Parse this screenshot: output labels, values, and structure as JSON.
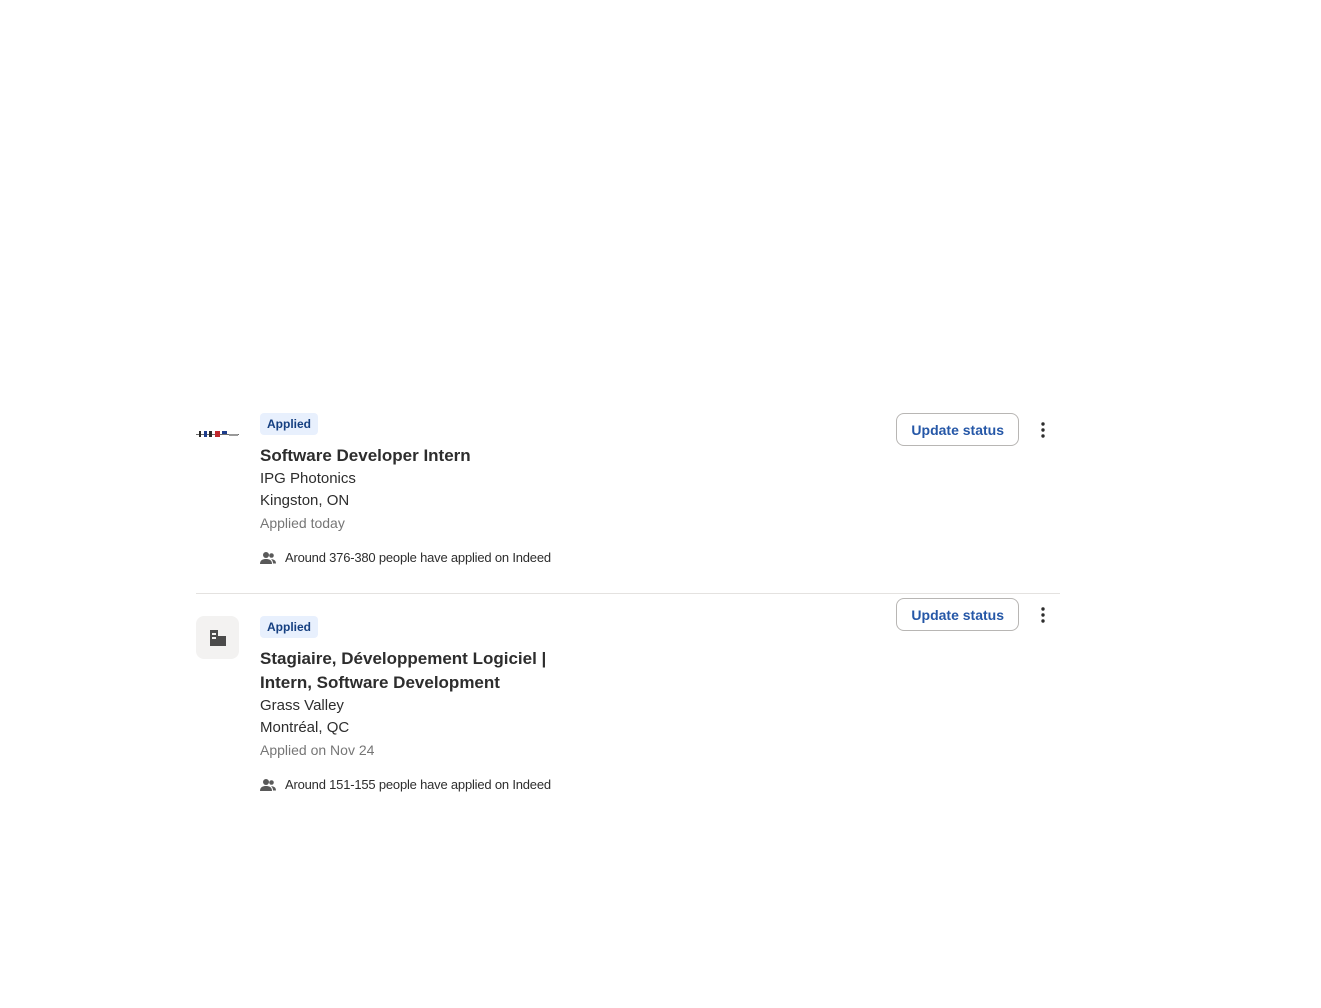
{
  "jobs": [
    {
      "status_badge": "Applied",
      "title": "Software Developer Intern",
      "company": "IPG Photonics",
      "location": "Kingston, ON",
      "applied_date": "Applied today",
      "applicants": "Around 376-380 people have applied on Indeed",
      "update_button": "Update status",
      "logo": "ipg-photonics-logo"
    },
    {
      "status_badge": "Applied",
      "title": "Stagiaire, Développement Logiciel | Intern, Software Development",
      "company": "Grass Valley",
      "location": "Montréal, QC",
      "applied_date": "Applied on Nov 24",
      "applicants": "Around 151-155 people have applied on Indeed",
      "update_button": "Update status",
      "logo": "company-building-icon"
    }
  ],
  "icons": {
    "applicants": "people-icon",
    "more": "more-options-vertical-icon"
  },
  "colors": {
    "badge_bg": "#e8f0fd",
    "badge_text": "#164081",
    "button_text": "#2557a7",
    "muted_text": "#767676"
  }
}
